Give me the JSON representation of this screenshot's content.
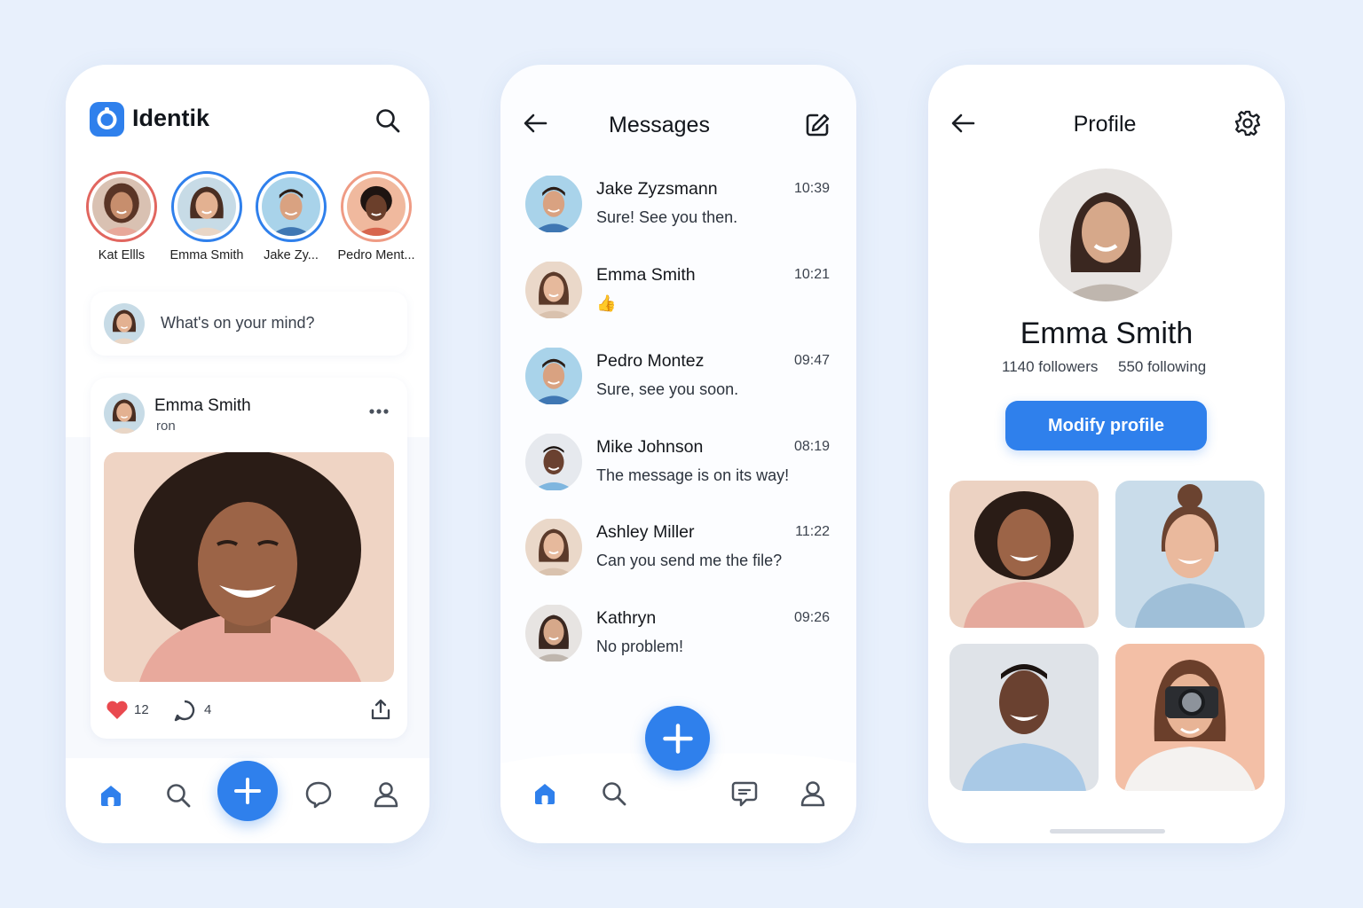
{
  "colors": {
    "accent": "#2f80ec",
    "background": "#e8f0fc",
    "like": "#e9494f"
  },
  "feed": {
    "app_title": "Identik",
    "stories": [
      {
        "name": "Kat Ellls",
        "ring": "#e1665f"
      },
      {
        "name": "Emma Smith",
        "ring": "#2f80ec"
      },
      {
        "name": "Jake Zy...",
        "ring": "#2f80ec"
      },
      {
        "name": "Pedro Ment...",
        "ring": "#ef9b84"
      }
    ],
    "composer_placeholder": "What's on your mind?",
    "post": {
      "author": "Emma Smith",
      "subtitle": "ron",
      "likes": "12",
      "comments": "4"
    },
    "nav": [
      "home-icon",
      "search-icon",
      "plus-icon",
      "chat-bubble-icon",
      "profile-icon"
    ]
  },
  "messages": {
    "title": "Messages",
    "items": [
      {
        "name": "Jake Zyzsmann",
        "time": "10:39",
        "text": "Sure! See you then."
      },
      {
        "name": "Emma Smith",
        "time": "10:21",
        "text": "👍"
      },
      {
        "name": "Pedro Montez",
        "time": "09:47",
        "text": "Sure, see you soon."
      },
      {
        "name": "Mike Johnson",
        "time": "08:19",
        "text": "The message is on its way!"
      },
      {
        "name": "Ashley Miller",
        "time": "11:22",
        "text": "Can you send me the file?"
      },
      {
        "name": "Kathryn",
        "time": "09:26",
        "text": "No problem!"
      }
    ]
  },
  "profile": {
    "title": "Profile",
    "name": "Emma Smith",
    "followers": "1140 followers",
    "following": "550 following",
    "button": "Modify profile"
  }
}
